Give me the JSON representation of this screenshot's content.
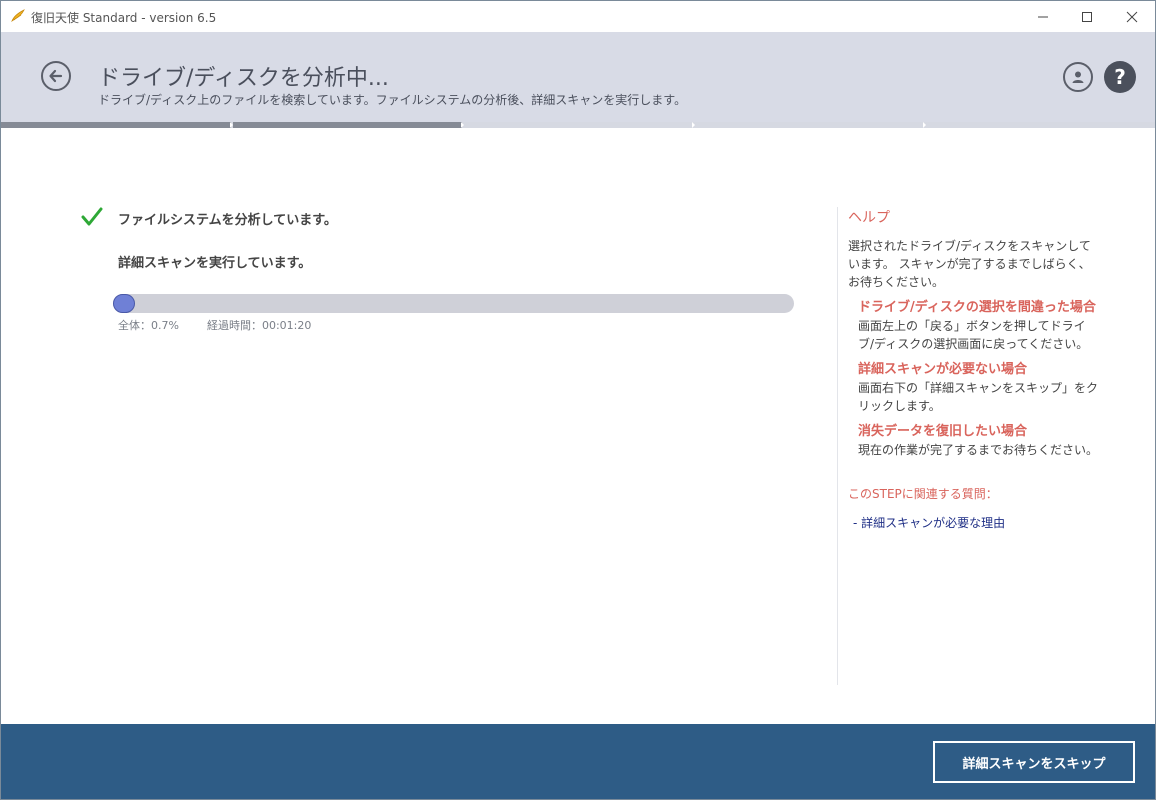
{
  "window": {
    "title": "復旧天使 Standard - version 6.5",
    "icon": "angel-wing-icon",
    "controls": [
      "minimize-icon",
      "maximize-icon",
      "close-icon"
    ]
  },
  "header": {
    "title": "ドライブ/ディスクを分析中...",
    "subtitle": "ドライブ/ディスク上のファイルを検索しています。ファイルシステムの分析後、詳細スキャンを実行します。",
    "back_icon": "back-arrow-icon",
    "account_icon": "user-icon",
    "help_label": "?"
  },
  "steps": {
    "total": 5,
    "completed": 2
  },
  "main": {
    "status_done": "ファイルシステムを分析しています。",
    "status_current": "詳細スキャンを実行しています。",
    "progress": {
      "percent": 0.7,
      "overall_label": "全体：0.7%",
      "elapsed_label": "経過時間：00:01:20"
    }
  },
  "help": {
    "title": "ヘルプ",
    "intro": "選択されたドライブ/ディスクをスキャンしています。 スキャンが完了するまでしばらく、お待ちください。",
    "sections": [
      {
        "title": "ドライブ/ディスクの選択を間違った場合",
        "body": "画面左上の「戻る」ボタンを押してドライブ/ディスクの選択画面に戻ってください。"
      },
      {
        "title": "詳細スキャンが必要ない場合",
        "body": "画面右下の「詳細スキャンをスキップ」をクリックします。"
      },
      {
        "title": "消失データを復旧したい場合",
        "body": "現在の作業が完了するまでお待ちください。"
      }
    ],
    "faq_title": "このSTEPに関連する質問：",
    "faq_link": "- 詳細スキャンが必要な理由"
  },
  "footer": {
    "skip_label": "詳細スキャンをスキップ"
  },
  "colors": {
    "header_bg": "#d8dbe6",
    "footer_bg": "#2e5c86",
    "accent_red": "#d9645c",
    "progress_fill": "#6f80d6",
    "check_green": "#2ea836",
    "link_blue": "#1f2f86"
  }
}
